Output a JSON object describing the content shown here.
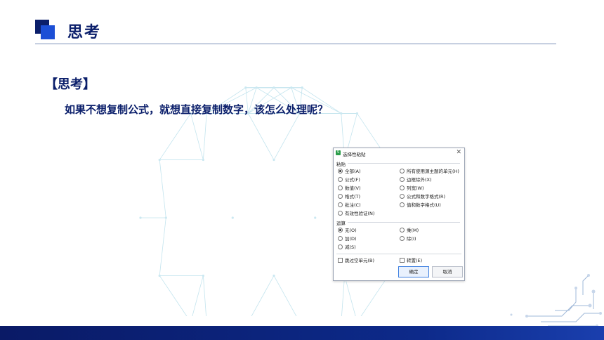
{
  "header": {
    "title": "思考"
  },
  "content": {
    "label": "【思考】",
    "question": "如果不想复制公式，就想直接复制数字，该怎么处理呢？"
  },
  "dialog": {
    "title": "选择性粘贴",
    "close_icon": "close-icon",
    "paste_section": "粘贴",
    "paste_options_left": [
      "全部(A)",
      "公式(F)",
      "数值(V)",
      "格式(T)",
      "批注(C)",
      "有效性验证(N)"
    ],
    "paste_options_right": [
      "所有使用源主题的单元(H)",
      "边框除外(X)",
      "列宽(W)",
      "公式和数字格式(R)",
      "值和数字格式(U)"
    ],
    "paste_selected": "全部(A)",
    "operation_section": "运算",
    "operation_options_left": [
      "无(O)",
      "加(D)",
      "减(S)"
    ],
    "operation_options_right": [
      "乘(M)",
      "除(I)"
    ],
    "operation_selected": "无(O)",
    "skip_blanks": "跳过空单元(B)",
    "transpose": "转置(E)",
    "ok_label": "确定",
    "cancel_label": "取消"
  },
  "colors": {
    "accent": "#0b1f6b",
    "accent_light": "#1c4fd6",
    "band": "#0d2a8a",
    "globe": "#bfe3ee"
  }
}
